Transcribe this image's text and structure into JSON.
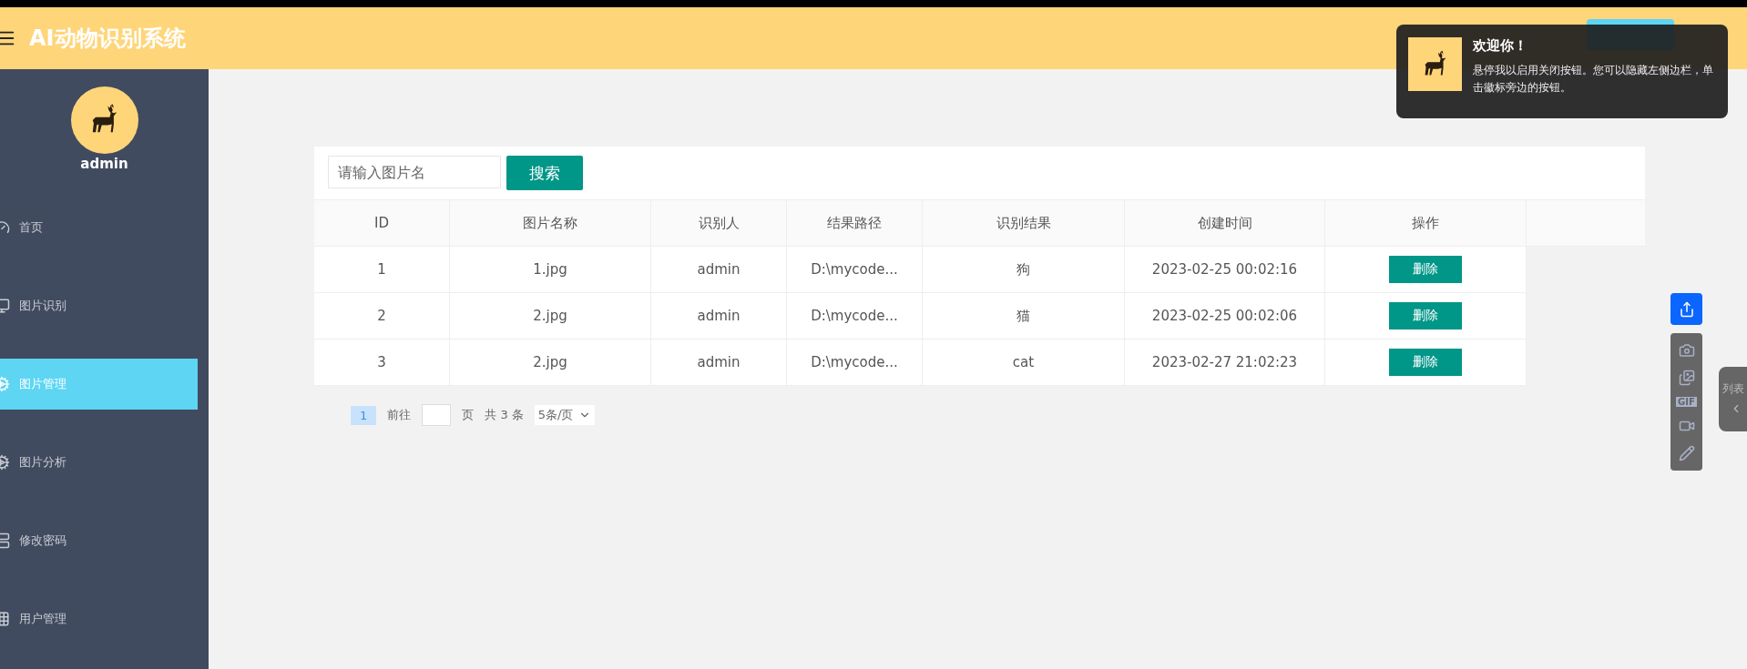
{
  "header": {
    "title": "AI动物识别系统"
  },
  "sidebar": {
    "user": "admin",
    "items": [
      {
        "label": "首页",
        "selected": false
      },
      {
        "label": "图片识别",
        "selected": false
      },
      {
        "label": "图片管理",
        "selected": true
      },
      {
        "label": "图片分析",
        "selected": false
      },
      {
        "label": "修改密码",
        "selected": false
      },
      {
        "label": "用户管理",
        "selected": false
      }
    ]
  },
  "search": {
    "placeholder": "请输入图片名",
    "button": "搜索"
  },
  "table": {
    "columns": [
      "ID",
      "图片名称",
      "识别人",
      "结果路径",
      "识别结果",
      "创建时间",
      "操作"
    ],
    "rows": [
      {
        "cells": [
          "1",
          "1.jpg",
          "admin",
          "D:\\mycode...",
          "狗",
          "2023-02-25 00:02:16"
        ],
        "action": "删除"
      },
      {
        "cells": [
          "2",
          "2.jpg",
          "admin",
          "D:\\mycode...",
          "猫",
          "2023-02-25 00:02:06"
        ],
        "action": "删除"
      },
      {
        "cells": [
          "3",
          "2.jpg",
          "admin",
          "D:\\mycode...",
          "cat",
          "2023-02-27 21:02:23"
        ],
        "action": "删除"
      }
    ]
  },
  "pagination": {
    "page": "1",
    "goto_label": "前往",
    "page_unit": "页",
    "total": "共 3 条",
    "page_size": "5条/页"
  },
  "toast": {
    "title": "欢迎你！",
    "message": "悬停我以启用关闭按钮。您可以隐藏左侧边栏，单击徽标旁边的按钮。"
  },
  "side_tab": {
    "label": "列表"
  },
  "tools": {
    "gif": "GIF"
  }
}
